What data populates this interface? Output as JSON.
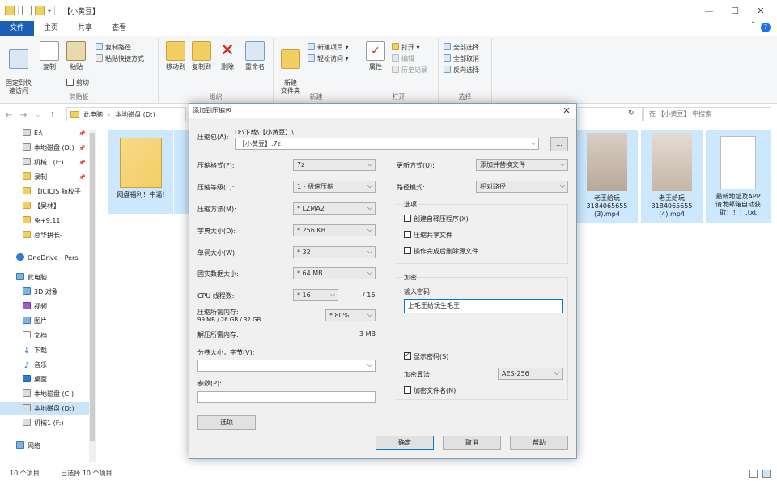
{
  "window": {
    "title": "【小黄豆】",
    "controls": {
      "minimize": "—",
      "maximize": "☐",
      "close": "✕"
    }
  },
  "ribbon": {
    "tabs": [
      "文件",
      "主页",
      "共享",
      "查看"
    ],
    "collapse": "⌃",
    "help": "?",
    "groups": {
      "clipboard": {
        "label": "剪贴板",
        "pin_quick": "固定到快\n速访问",
        "copy": "复制",
        "paste": "粘贴",
        "copy_path": "复制路径",
        "paste_shortcut": "粘贴快捷方式",
        "cut": "剪切"
      },
      "organize": {
        "label": "组织",
        "move_to": "移动到",
        "copy_to": "复制到",
        "delete": "删除",
        "rename": "重命名"
      },
      "new": {
        "label": "新建",
        "new_folder": "新建\n文件夹",
        "new_item": "新建项目 ▾",
        "easy_access": "轻松访问 ▾"
      },
      "open": {
        "label": "打开",
        "properties": "属性",
        "open": "打开 ▾",
        "edit": "编辑",
        "history": "历史记录"
      },
      "select": {
        "label": "选择",
        "select_all": "全部选择",
        "select_none": "全部取消",
        "invert": "反向选择"
      }
    }
  },
  "address": {
    "crumbs": [
      "此电脑",
      "本地磁盘 (D:)"
    ],
    "search_placeholder": "在 【小黄豆】 中搜索",
    "refresh": "↻",
    "nav": {
      "back": "←",
      "forward": "→",
      "recent": "⌵",
      "up": "↑"
    }
  },
  "sidebar": {
    "items": [
      {
        "label": "E:\\",
        "pinned": true,
        "icon": "drive-icon"
      },
      {
        "label": "本地磁盘 (D:)",
        "pinned": true,
        "icon": "drive-icon"
      },
      {
        "label": "机械1 (F:)",
        "pinned": true,
        "icon": "drive-icon"
      },
      {
        "label": "录制",
        "pinned": true,
        "icon": "folder-icon"
      },
      {
        "label": "【ICICIS 航校子",
        "pinned": false,
        "icon": "folder-icon"
      },
      {
        "label": "【吴林】",
        "pinned": false,
        "icon": "folder-icon"
      },
      {
        "label": "兔+9.11",
        "pinned": false,
        "icon": "folder-icon"
      },
      {
        "label": "总华拼长-",
        "pinned": false,
        "icon": "folder-icon"
      },
      {
        "label": "OneDrive - Pers",
        "pinned": false,
        "icon": "cloud-icon"
      },
      {
        "label": "此电脑",
        "pinned": false,
        "icon": "pc-icon"
      },
      {
        "label": "3D 对象",
        "pinned": false,
        "icon": "folder-icon"
      },
      {
        "label": "视频",
        "pinned": false,
        "icon": "folder-icon"
      },
      {
        "label": "图片",
        "pinned": false,
        "icon": "folder-icon"
      },
      {
        "label": "文档",
        "pinned": false,
        "icon": "folder-icon"
      },
      {
        "label": "下载",
        "pinned": false,
        "icon": "download-icon"
      },
      {
        "label": "音乐",
        "pinned": false,
        "icon": "music-icon"
      },
      {
        "label": "桌面",
        "pinned": false,
        "icon": "folder-icon"
      },
      {
        "label": "本地磁盘 (C:)",
        "pinned": false,
        "icon": "drive-icon"
      },
      {
        "label": "本地磁盘 (D:)",
        "pinned": false,
        "icon": "drive-icon"
      },
      {
        "label": "机械1 (F:)",
        "pinned": false,
        "icon": "drive-icon"
      },
      {
        "label": "网络",
        "pinned": false,
        "icon": "network-icon"
      }
    ]
  },
  "files": [
    {
      "name": "网盘福利！牛逼!"
    },
    {
      "name": "老王给玩\n3184065655\n(3).mp4"
    },
    {
      "name": "老王给玩\n3184065655\n(4).mp4"
    },
    {
      "name": "最新地址及APP\n请发邮箱自动获\n取！！！.txt"
    }
  ],
  "status": {
    "count": "10 个项目",
    "selected": "已选择 10 个项目"
  },
  "dialog": {
    "title": "添加到压缩包",
    "close": "✕",
    "archive_label": "压缩包(A):",
    "archive_path": "D:\\下载\\【小黄豆】\\",
    "archive_name": "【小黄豆】.7z",
    "browse": "...",
    "format_label": "压缩格式(F):",
    "format_value": "7z",
    "level_label": "压缩等级(L):",
    "level_value": "1 - 极速压缩",
    "method_label": "压缩方法(M):",
    "method_value": "* LZMA2",
    "dict_label": "字典大小(D):",
    "dict_value": "* 256 KB",
    "word_label": "单词大小(W):",
    "word_value": "* 32",
    "solid_label": "固实数据大小:",
    "solid_value": "* 64 MB",
    "cpu_label": "CPU 线程数:",
    "cpu_value": "* 16",
    "cpu_max": "/ 16",
    "mem_label": "压缩所需内存:",
    "mem_detail": "99 MB / 26 GB / 32 GB",
    "mem_value": "* 80%",
    "decomp_label": "解压所需内存:",
    "decomp_value": "3 MB",
    "split_label": "分卷大小，字节(V):",
    "split_value": "",
    "params_label": "参数(P):",
    "params_value": "",
    "options_btn": "选项",
    "update_label": "更新方式(U):",
    "update_value": "添加并替换文件",
    "path_label": "路径模式:",
    "path_value": "相对路径",
    "options_group": "选项",
    "opt_sfx": "创建自释压程序(X)",
    "opt_shared": "压缩共享文件",
    "opt_delete": "操作完成后删除源文件",
    "encrypt_group": "加密",
    "password_label": "输入密码:",
    "password_value": "上毛王给玩生毛王",
    "show_password": "显示密码(S)",
    "enc_method_label": "加密算法:",
    "enc_method_value": "AES-256",
    "enc_names": "加密文件名(N)",
    "ok": "确定",
    "cancel": "取消",
    "help": "帮助"
  }
}
